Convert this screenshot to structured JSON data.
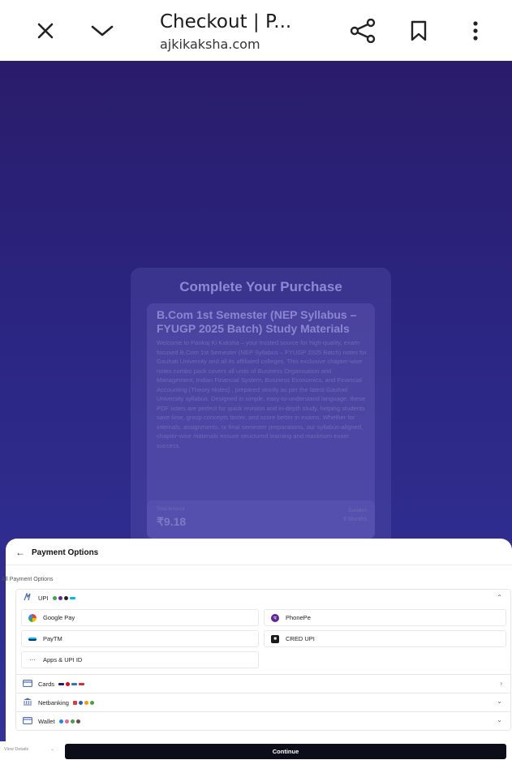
{
  "browser": {
    "title": "Checkout | P...",
    "url": "ajkikaksha.com"
  },
  "page": {
    "heading": "Complete Your Purchase",
    "product_title": "B.Com 1st Semester (NEP Syllabus – FYUGP 2025 Batch) Study Materials",
    "description": "Welcome to Pankaj Ki Kaksha – your trusted source for high-quality, exam-focused B.Com 1st Semester (NEP Syllabus – FYUGP 2025 Batch) notes for Gauhati University and all its affiliated colleges. This exclusive chapter-wise notes combo pack covers all units of Business Organisation and Management, Indian Financial System, Business Economics, and Financial Accounting (Theory Notes) , prepared strictly as per the latest Gauhati University syllabus. Designed in simple, easy-to-understand language, these PDF notes are perfect for quick revision and in-depth study, helping students save time, grasp concepts faster, and score better in exams. Whether for internals, assignments, or final semester preparations, our syllabus-aligned, chapter-wise materials ensure structured learning and maximum exam success.",
    "total_label": "Total Amount",
    "total_value": "₹9.18",
    "duration_label": "Duration",
    "duration_value": "6 Months"
  },
  "sheet": {
    "title": "Payment Options",
    "all_label": "All Payment Options",
    "upi": {
      "label": "UPI",
      "options": [
        {
          "label": "Google Pay",
          "icon": "google-pay-icon"
        },
        {
          "label": "PhonePe",
          "icon": "phonepe-icon"
        },
        {
          "label": "PayTM",
          "icon": "paytm-icon"
        },
        {
          "label": "CRED UPI",
          "icon": "cred-icon"
        },
        {
          "label": "Apps & UPI ID",
          "icon": "more-icon"
        }
      ]
    },
    "cards": {
      "label": "Cards"
    },
    "netbanking": {
      "label": "Netbanking"
    },
    "wallet": {
      "label": "Wallet"
    }
  },
  "footer": {
    "view_details": "View Details",
    "continue": "Continue"
  },
  "colors": {
    "bg_top": "#2a1c6a",
    "bg_bottom": "#33349b",
    "continue_bg": "#0d0d1a",
    "phonepe": "#5f259f",
    "gpay": "#4285f4"
  }
}
